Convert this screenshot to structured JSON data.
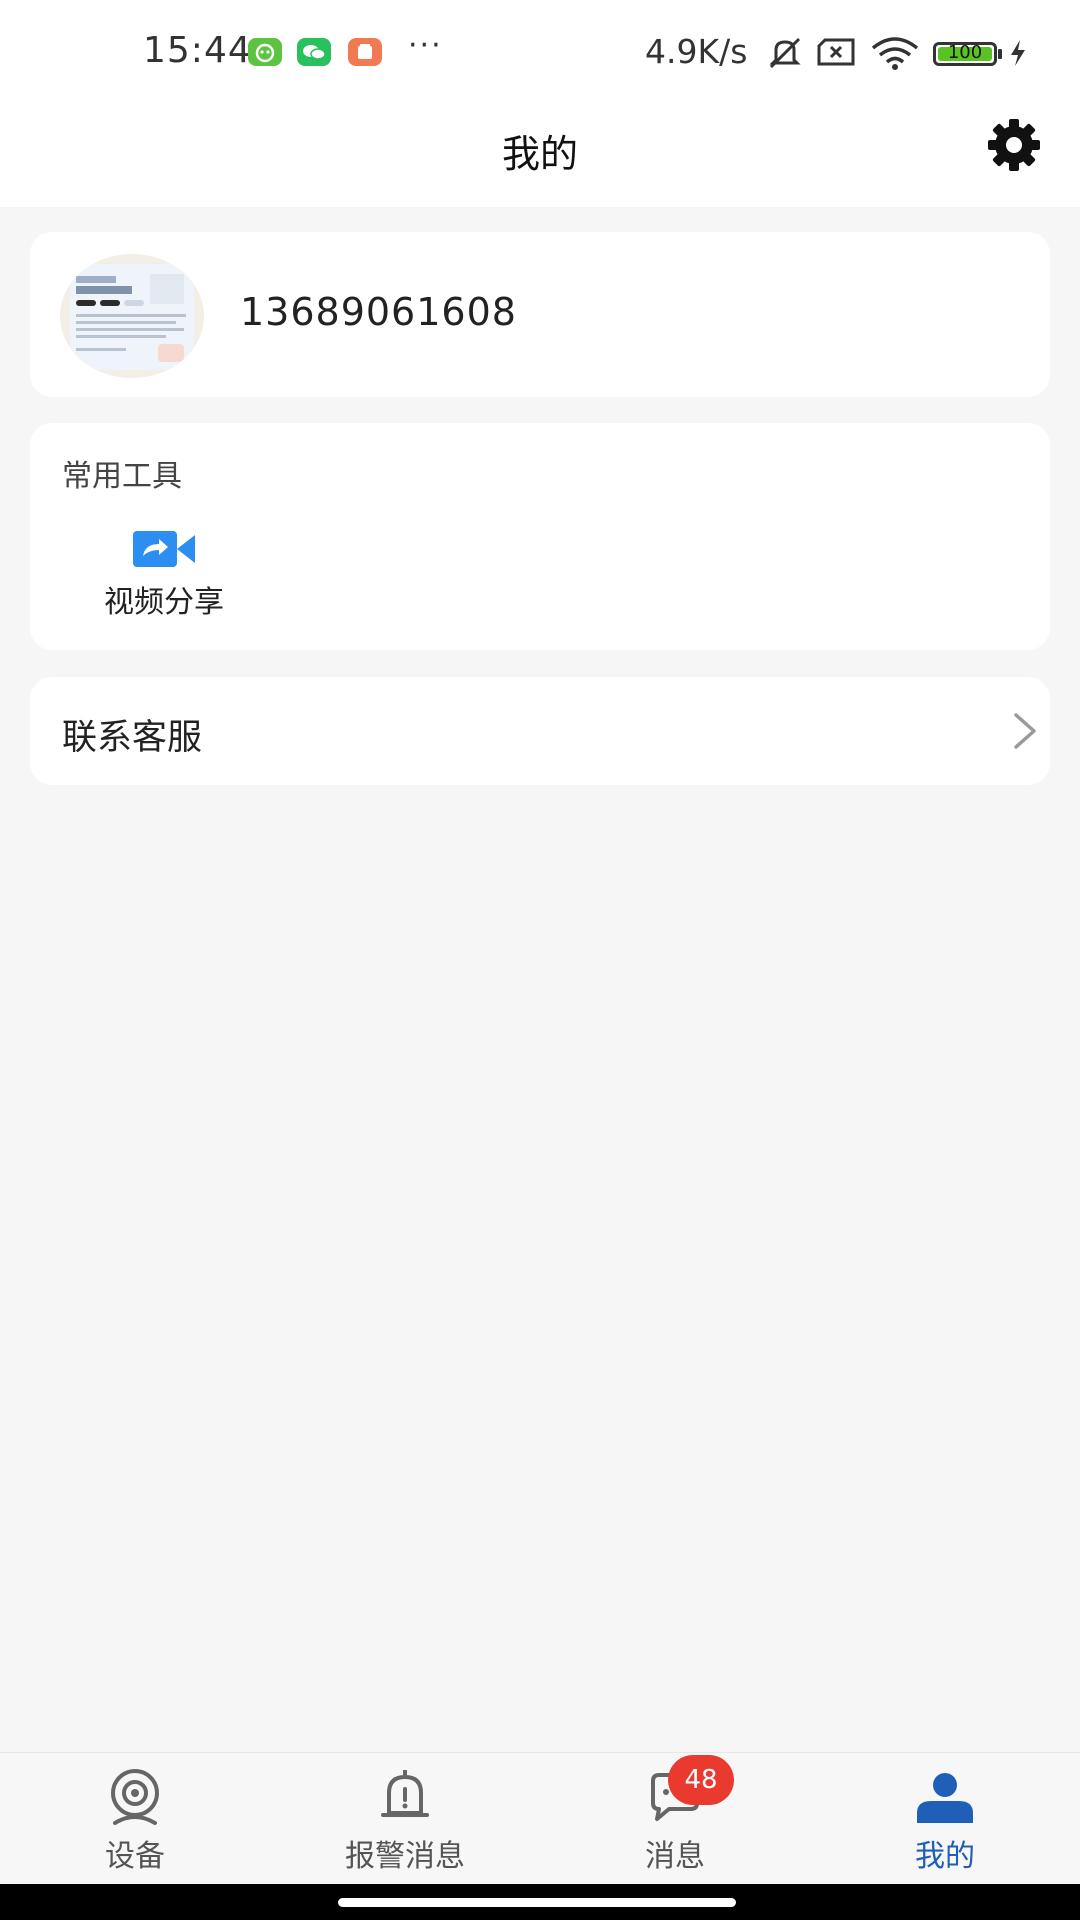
{
  "status_bar": {
    "time": "15:44",
    "apps": [
      {
        "icon": "bilibili-app-icon",
        "color": "#5cc440"
      },
      {
        "icon": "wechat-app-icon",
        "color": "#29c15e"
      },
      {
        "icon": "app-store-icon",
        "color": "#f07a52"
      }
    ],
    "more": "···",
    "network_speed": "4.9K/s",
    "icons": [
      "mute-bell-icon",
      "sim-off-icon",
      "wifi-icon"
    ],
    "battery_level": "100",
    "charging_icon": "lightning-icon"
  },
  "header": {
    "title": "我的",
    "settings_icon": "gear-icon"
  },
  "profile": {
    "avatar_icon": "avatar-image",
    "phone": "13689061608"
  },
  "tools": {
    "title": "常用工具",
    "items": [
      {
        "label": "视频分享",
        "icon": "video-share-icon",
        "color": "#2b8ef0"
      }
    ]
  },
  "service": {
    "label": "联系客服",
    "icon": "chevron-right-icon"
  },
  "tabbar": {
    "items": [
      {
        "label": "设备",
        "icon": "camera-icon",
        "active": false
      },
      {
        "label": "报警消息",
        "icon": "alarm-bell-icon",
        "active": false
      },
      {
        "label": "消息",
        "icon": "chat-icon",
        "badge": "48",
        "active": false
      },
      {
        "label": "我的",
        "icon": "person-icon",
        "active": true
      }
    ],
    "active_color": "#1f5fb8",
    "badge_color": "#ea3a30"
  }
}
